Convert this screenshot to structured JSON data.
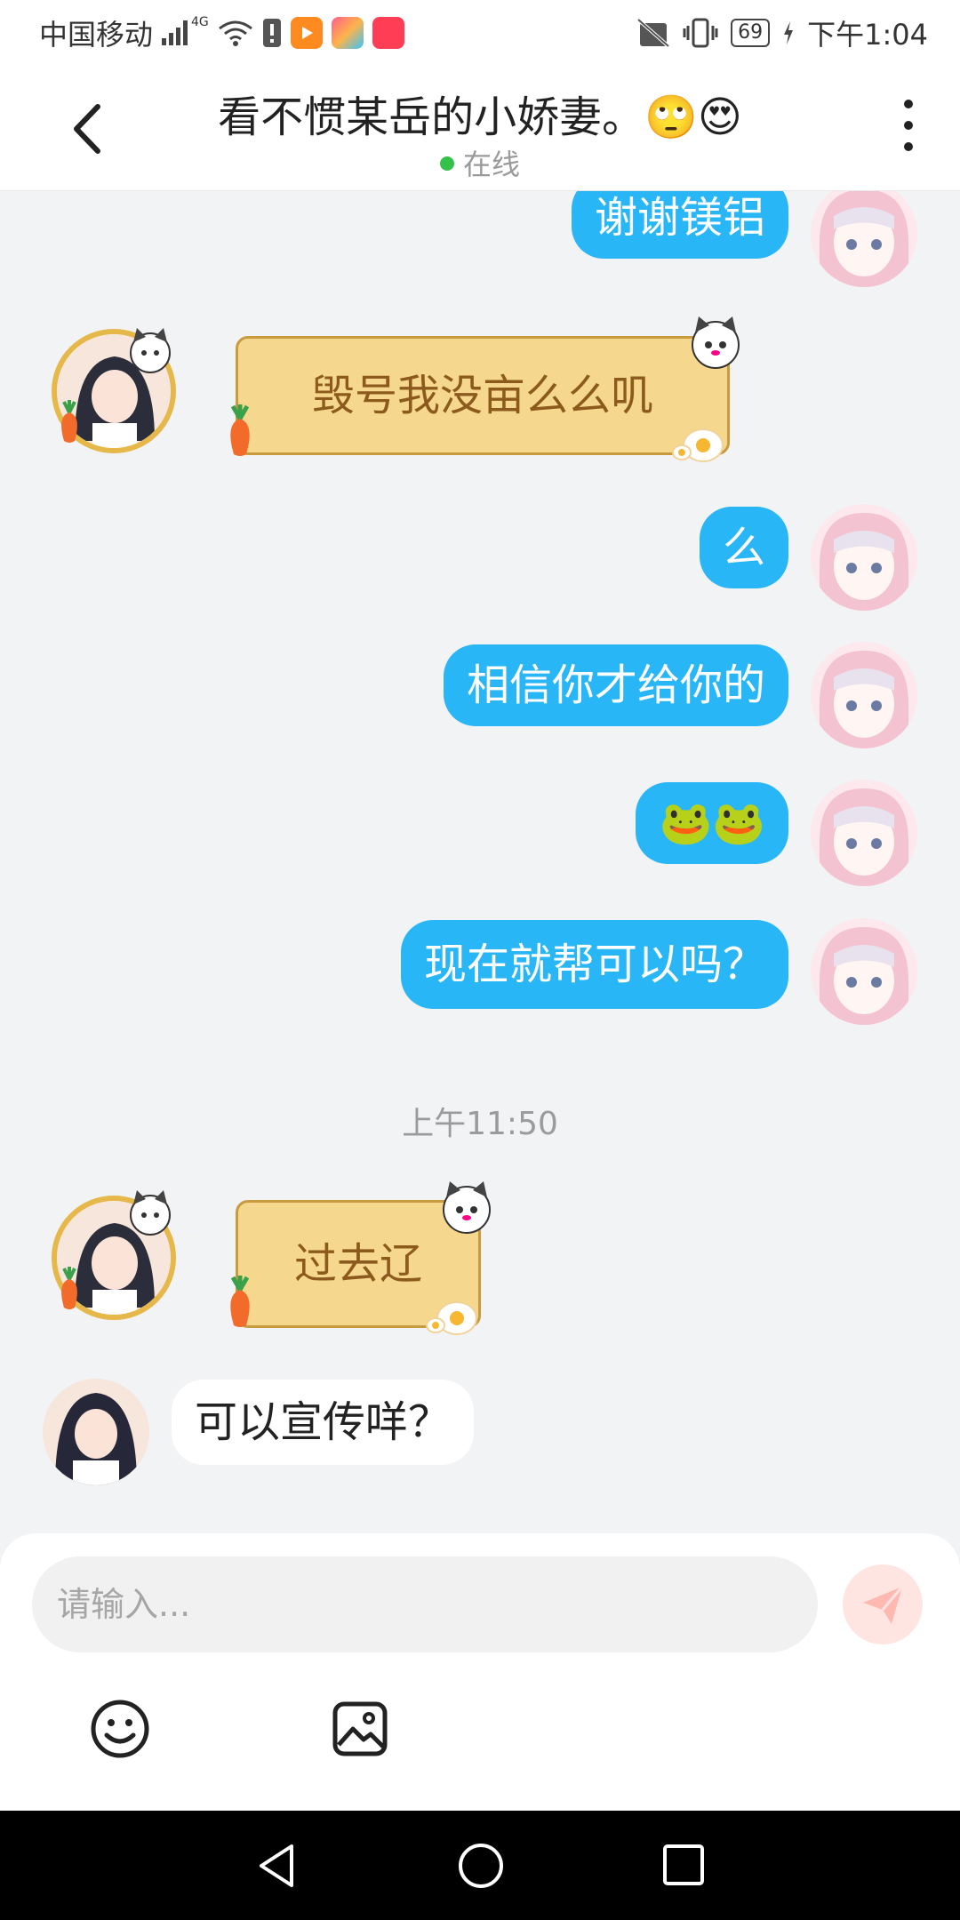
{
  "status_bar": {
    "carrier": "中国移动",
    "network_type": "4G",
    "battery": "69",
    "time": "下午1:04"
  },
  "header": {
    "title": "看不惯某岳的小娇妻。🙄😍",
    "status": "在线"
  },
  "messages": [
    {
      "side": "right",
      "text": "谢谢镁铝"
    },
    {
      "side": "left",
      "style": "note",
      "text": "毁号我没亩么么叽"
    },
    {
      "side": "right",
      "text": "么"
    },
    {
      "side": "right",
      "text": "相信你才给你的"
    },
    {
      "side": "right",
      "text": "🐸🐸"
    },
    {
      "side": "right",
      "text": "现在就帮可以吗？"
    },
    {
      "type": "timestamp",
      "text": "上午11:50"
    },
    {
      "side": "left",
      "style": "note",
      "text": "过去辽"
    },
    {
      "side": "left",
      "text": "可以宣传咩？"
    }
  ],
  "input": {
    "placeholder": "请输入..."
  },
  "colors": {
    "accent_bubble": "#29b6f6",
    "online_dot": "#34c24a",
    "send_button_bg": "#ffe5e2",
    "note_bubble_bg": "#f5d88d"
  }
}
